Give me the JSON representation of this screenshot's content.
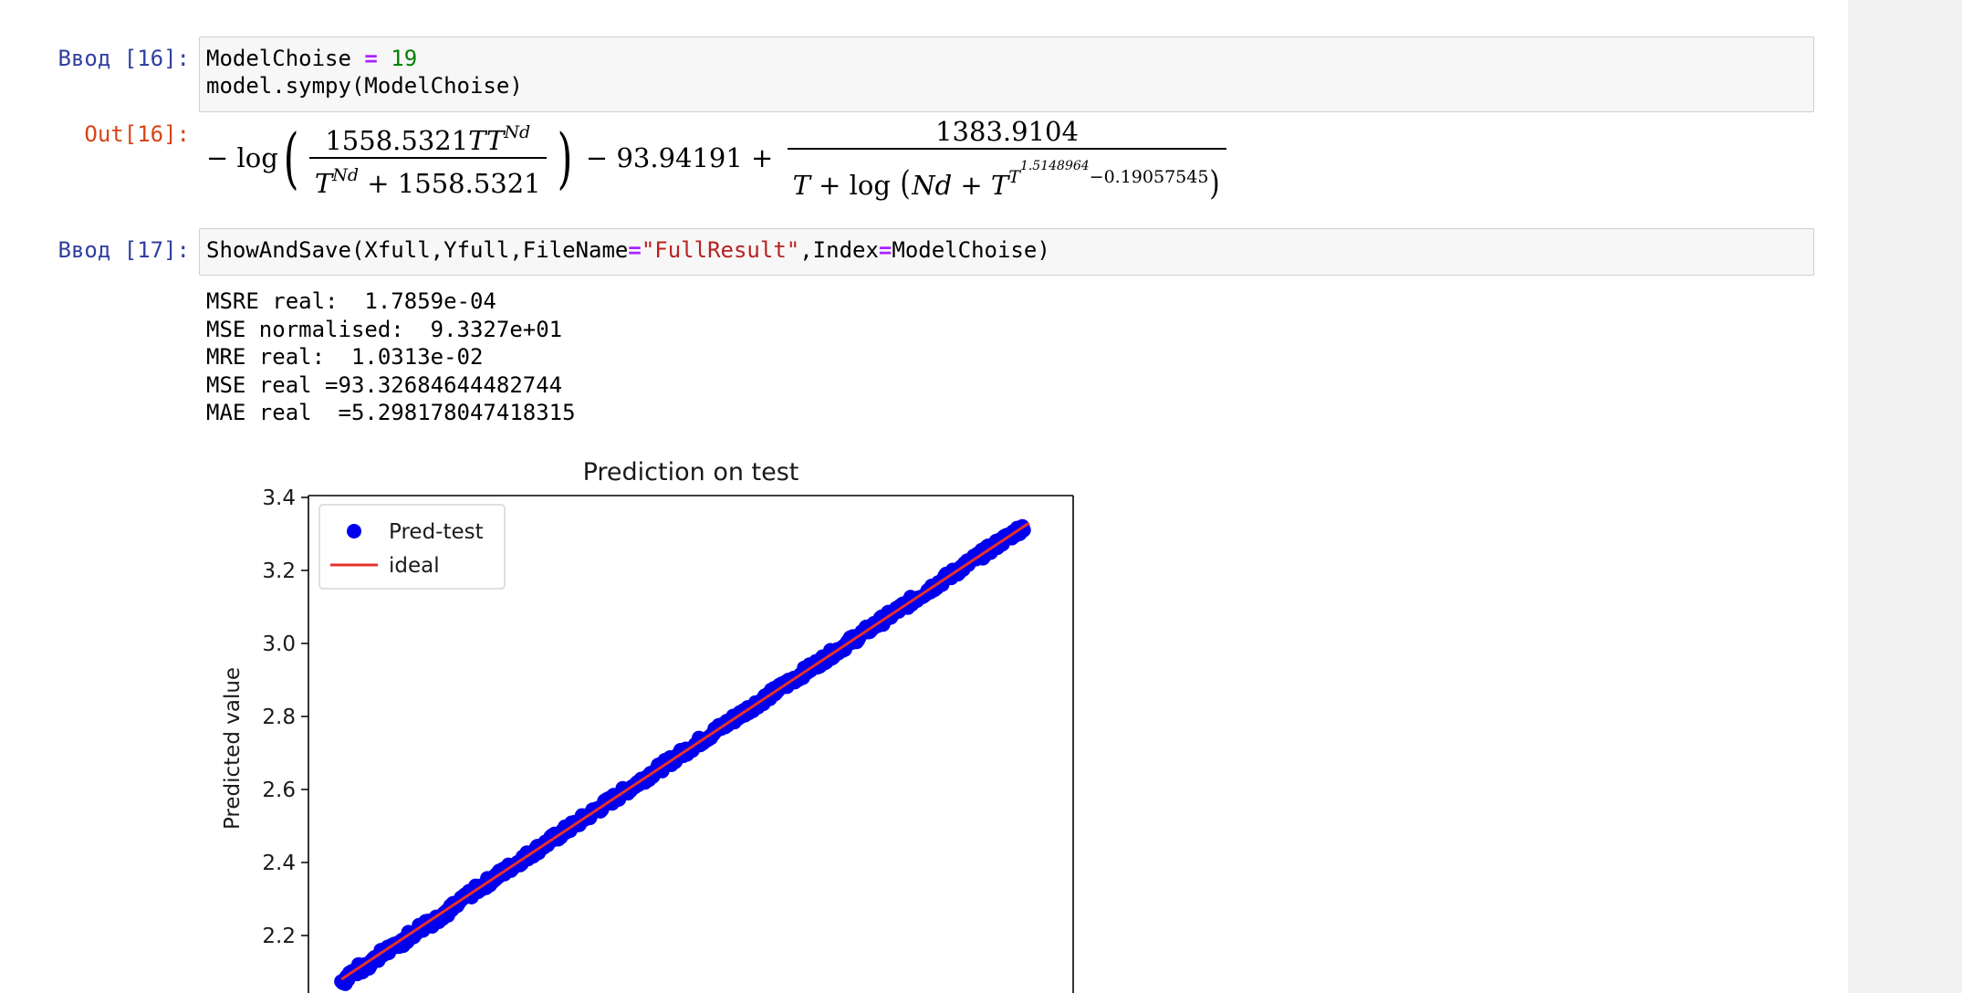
{
  "cells": {
    "in16": {
      "prompt": "Ввод [16]:",
      "line1_a": "ModelChoise ",
      "line1_op": "=",
      "line1_num": " 19",
      "line2": "model.sympy(ModelChoise)"
    },
    "out16": {
      "prompt": "Out[16]:"
    },
    "in17": {
      "prompt": "Ввод [17]:",
      "code_a": "ShowAndSave(Xfull,Yfull,FileName",
      "code_op1": "=",
      "code_str": "\"FullResult\"",
      "code_b": ",Index",
      "code_op2": "=",
      "code_c": "ModelChoise)"
    }
  },
  "math": {
    "neg_log": "− log",
    "frac1_num_a": "1558.5321",
    "frac1_num_b": "TT",
    "frac1_num_sup": "Nd",
    "frac1_den_a": "T",
    "frac1_den_sup": "Nd",
    "frac1_den_b": " + 1558.5321",
    "mid": " − 93.94191 + ",
    "frac2_num": "1383.9104",
    "frac2_den_a": "T",
    "frac2_den_b": " + log ",
    "frac2_den_c": "Nd",
    "frac2_den_d": " + ",
    "frac2_den_e": "T",
    "frac2_den_sup_t": "T",
    "frac2_den_sup_exp": "1.5148964",
    "frac2_den_sup_rest": "−0.19057545"
  },
  "stream": {
    "lines": [
      "MSRE real:  1.7859e-04",
      "MSE normalised:  9.3327e+01",
      "MRE real:  1.0313e-02",
      "MSE real =93.32684644482744",
      "MAE real  =5.298178047418315"
    ]
  },
  "chart_data": {
    "type": "scatter",
    "title": "Prediction on test",
    "xlabel": "",
    "ylabel": "Predicted value",
    "ylim": [
      2.05,
      3.4
    ],
    "xlim": [
      2.02,
      3.41
    ],
    "yticks": [
      "3.4",
      "3.2",
      "3.0",
      "2.8",
      "2.6",
      "2.4",
      "2.2"
    ],
    "legend": [
      "Pred-test",
      "ideal"
    ],
    "legend_position": "top-left",
    "colors": {
      "points": "#0000ee",
      "ideal": "#e8312a"
    },
    "series": [
      {
        "name": "Pred-test",
        "x_range": [
          2.08,
          3.32
        ],
        "y_range": [
          2.08,
          3.32
        ]
      },
      {
        "name": "ideal",
        "x": [
          2.08,
          3.33
        ],
        "y": [
          2.08,
          3.33
        ]
      }
    ]
  }
}
